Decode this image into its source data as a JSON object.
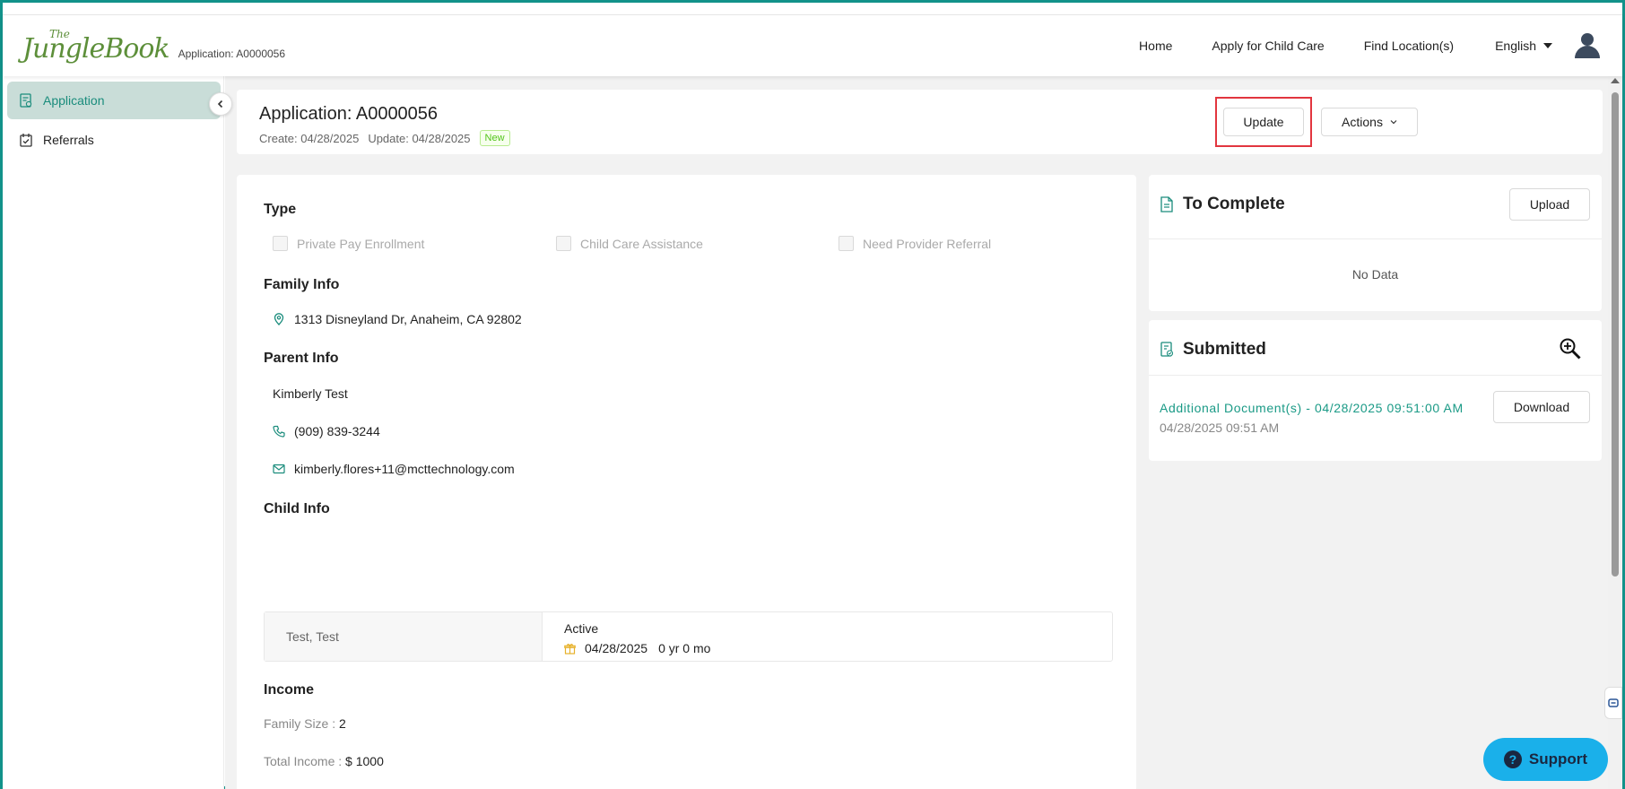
{
  "header": {
    "logo_the": "The",
    "logo_main": "JungleBook",
    "app_code": "Application: A0000056",
    "nav": [
      "Home",
      "Apply for Child Care",
      "Find Location(s)"
    ],
    "language": "English",
    "avatar_icon": "user-icon"
  },
  "sidebar": {
    "items": [
      {
        "label": "Application",
        "icon": "application-doc-icon",
        "active": true
      },
      {
        "label": "Referrals",
        "icon": "calendar-check-icon",
        "active": false
      }
    ]
  },
  "title_card": {
    "title": "Application: A0000056",
    "created": "Create: 04/28/2025",
    "updated": "Update: 04/28/2025",
    "status_badge": "New",
    "update_button": "Update",
    "actions_button": "Actions"
  },
  "type": {
    "heading": "Type",
    "options": [
      "Private Pay Enrollment",
      "Child Care Assistance",
      "Need Provider Referral"
    ]
  },
  "family_info": {
    "heading": "Family Info",
    "address": "1313 Disneyland Dr, Anaheim, CA 92802"
  },
  "parent_info": {
    "heading": "Parent Info",
    "name": "Kimberly Test",
    "phone": "(909) 839-3244",
    "email": "kimberly.flores+11@mcttechnology.com"
  },
  "child_info": {
    "heading": "Child Info",
    "name": "Test, Test",
    "status": "Active",
    "dob": "04/28/2025",
    "age": "0 yr 0 mo"
  },
  "income": {
    "heading": "Income",
    "family_size_label": "Family Size :",
    "family_size": "2",
    "total_income_label": "Total Income :",
    "total_income": "$ 1000"
  },
  "to_complete": {
    "heading": "To Complete",
    "upload_button": "Upload",
    "empty_text": "No Data"
  },
  "submitted": {
    "heading": "Submitted",
    "doc_title": "Additional Document(s) - 04/28/2025 09:51:00 AM",
    "doc_date": "04/28/2025 09:51 AM",
    "download_button": "Download"
  },
  "support": {
    "label": "Support"
  },
  "colors": {
    "accent": "#1a9a86",
    "frame": "#12928a",
    "highlight": "#e2363f",
    "support": "#1ab0ea"
  }
}
